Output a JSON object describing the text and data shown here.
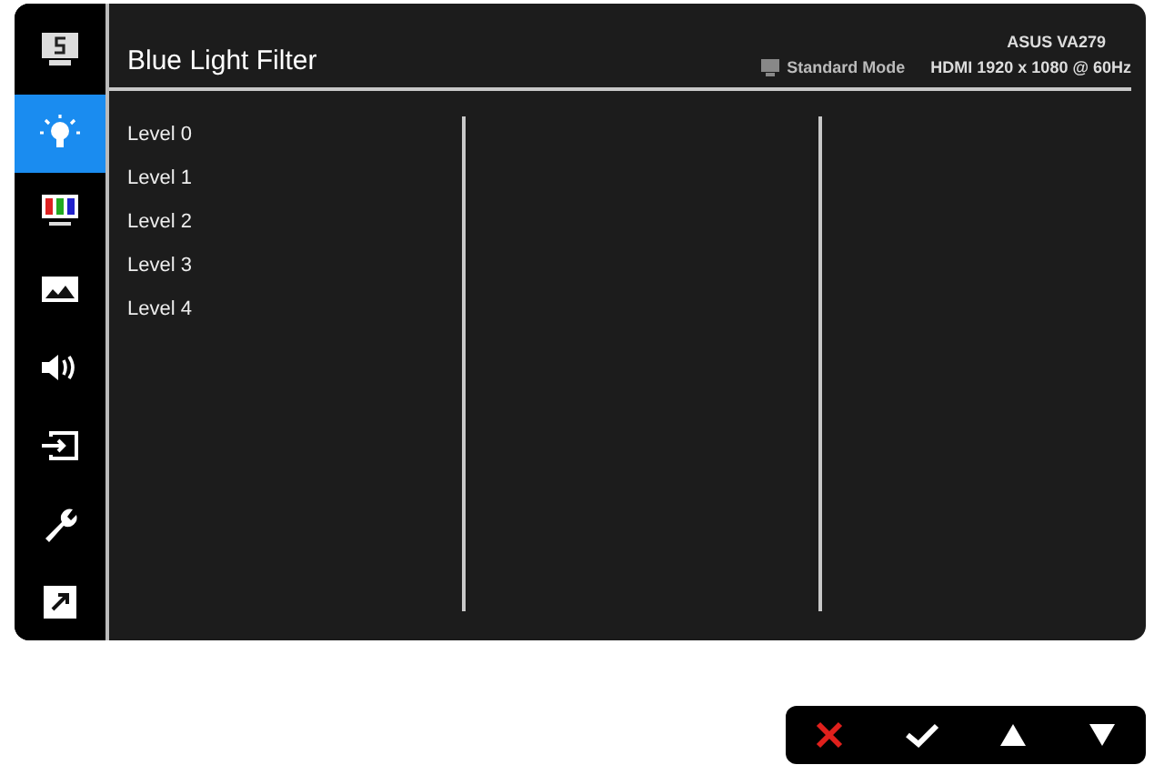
{
  "sidebar": {
    "items": [
      {
        "kind": "splendid",
        "selected": false
      },
      {
        "kind": "bulb",
        "selected": true
      },
      {
        "kind": "color",
        "selected": false
      },
      {
        "kind": "image",
        "selected": false
      },
      {
        "kind": "sound",
        "selected": false
      },
      {
        "kind": "input",
        "selected": false
      },
      {
        "kind": "wrench",
        "selected": false
      },
      {
        "kind": "shortcut",
        "selected": false
      }
    ]
  },
  "header": {
    "title": "Blue Light Filter",
    "model": "ASUS VA279",
    "mode": "Standard Mode",
    "signal": "HDMI 1920 x 1080 @ 60Hz"
  },
  "options": [
    "Level 0",
    "Level 1",
    "Level 2",
    "Level 3",
    "Level 4"
  ],
  "keys": [
    {
      "kind": "close"
    },
    {
      "kind": "ok"
    },
    {
      "kind": "up"
    },
    {
      "kind": "down"
    }
  ]
}
